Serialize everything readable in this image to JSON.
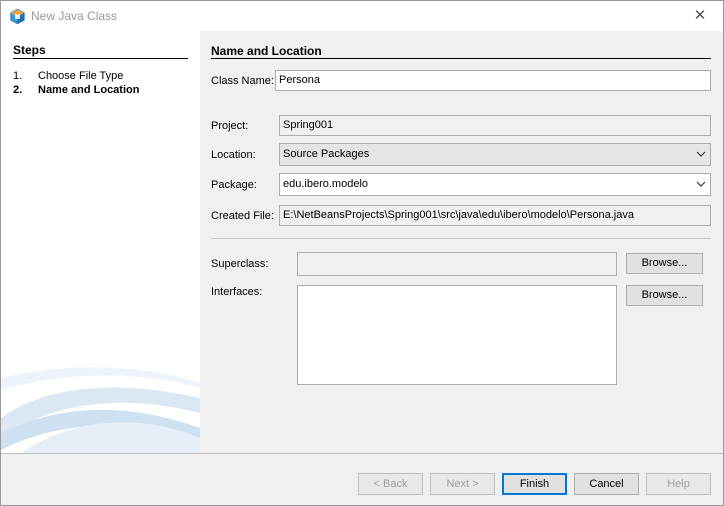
{
  "window": {
    "title": "New Java Class",
    "close_glyph": "✕"
  },
  "steps": {
    "title": "Steps",
    "items": [
      {
        "num": "1.",
        "label": "Choose File Type"
      },
      {
        "num": "2.",
        "label": "Name and Location"
      }
    ]
  },
  "section": {
    "title": "Name and Location"
  },
  "form": {
    "class_name_label": "Class Name:",
    "class_name_value": "Persona",
    "project_label": "Project:",
    "project_value": "Spring001",
    "location_label": "Location:",
    "location_value": "Source Packages",
    "package_label": "Package:",
    "package_value": "edu.ibero.modelo",
    "created_file_label": "Created File:",
    "created_file_value": "E:\\NetBeansProjects\\Spring001\\src\\java\\edu\\ibero\\modelo\\Persona.java",
    "superclass_label": "Superclass:",
    "superclass_value": "",
    "interfaces_label": "Interfaces:",
    "browse_label": "Browse..."
  },
  "buttons": {
    "back": "< Back",
    "next": "Next >",
    "finish": "Finish",
    "cancel": "Cancel",
    "help": "Help"
  },
  "icons": {
    "dropdown": "chevron-down-icon",
    "close": "close-icon",
    "app": "netbeans-cube-icon"
  },
  "colors": {
    "default_button_border": "#0078d7",
    "left_panel": "#ffffff",
    "content_bg": "#f0f0f0"
  }
}
